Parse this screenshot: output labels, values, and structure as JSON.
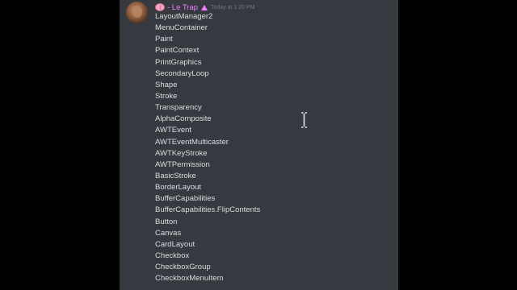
{
  "message": {
    "username": "- Le Trap",
    "timestamp": "Today at 1:20 PM",
    "icons": {
      "badge_left": "brain-emoji-icon",
      "badge_right": "triangle-icon",
      "cursor": "text-cursor-icon"
    },
    "lines": [
      "LayoutManager2",
      "MenuContainer",
      "Paint",
      "PaintContext",
      "PrintGraphics",
      "SecondaryLoop",
      "Shape",
      "Stroke",
      "Transparency",
      "AlphaComposite",
      "AWTEvent",
      "AWTEventMulticaster",
      "AWTKeyStroke",
      "AWTPermission",
      "BasicStroke",
      "BorderLayout",
      "BufferCapabilities",
      "BufferCapabilities.FlipContents",
      "Button",
      "Canvas",
      "CardLayout",
      "Checkbox",
      "CheckboxGroup",
      "CheckboxMenuItem"
    ]
  },
  "colors": {
    "background": "#36393f",
    "letterbox": "#000000",
    "username": "#f47fff",
    "text": "#dcddde",
    "timestamp": "#72767d"
  }
}
